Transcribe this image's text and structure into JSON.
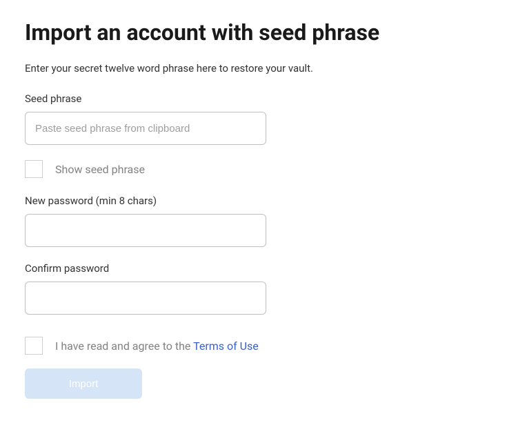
{
  "title": "Import an account with seed phrase",
  "subtitle": "Enter your secret twelve word phrase here to restore your vault.",
  "seed": {
    "label": "Seed phrase",
    "placeholder": "Paste seed phrase from clipboard",
    "value": "",
    "show_label": "Show seed phrase",
    "show_checked": false
  },
  "new_password": {
    "label": "New password (min 8 chars)",
    "value": ""
  },
  "confirm_password": {
    "label": "Confirm password",
    "value": ""
  },
  "terms": {
    "prefix": "I have read and agree to the ",
    "link_text": "Terms of Use",
    "checked": false
  },
  "import_button": "Import",
  "colors": {
    "link": "#3a5fcd",
    "button_disabled_bg": "#d6e4f7"
  }
}
